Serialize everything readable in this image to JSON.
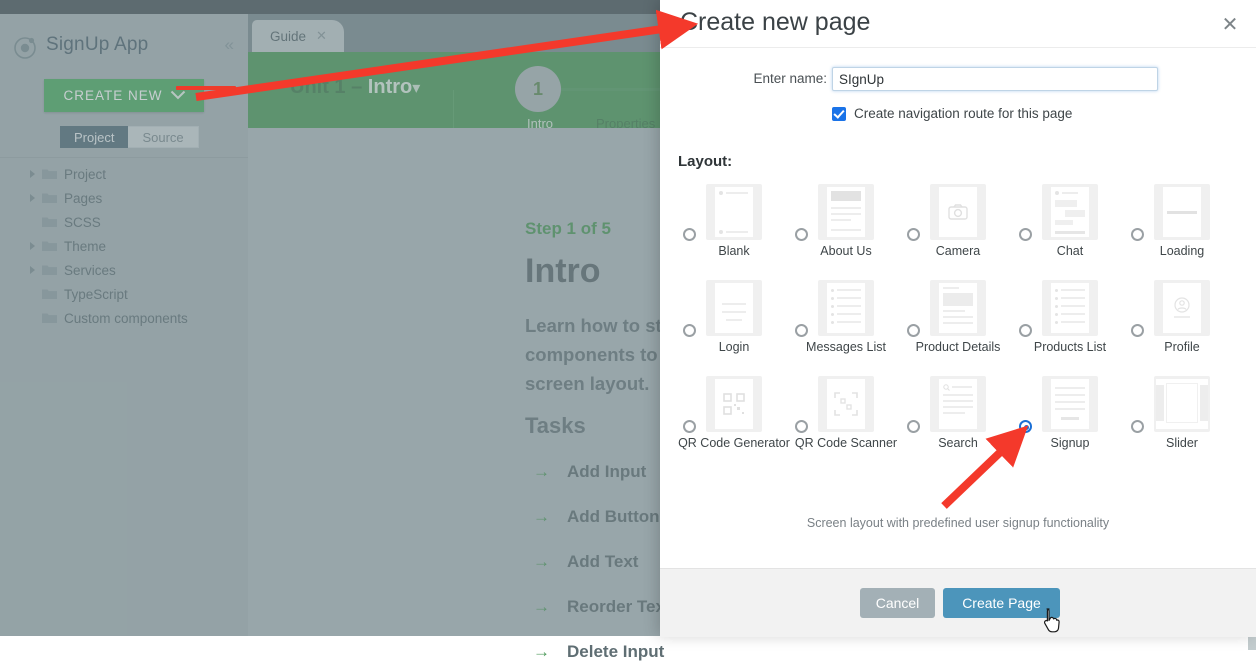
{
  "app": {
    "title": "SignUp App",
    "logo_icon": "target-orbit-icon",
    "collapse_icon": "chevron-double-left-icon",
    "create_new_label": "CREATE NEW",
    "create_new_chevron": "chevron-down-icon",
    "segments": [
      {
        "label": "Project",
        "active": true
      },
      {
        "label": "Source",
        "active": false
      }
    ],
    "tree": [
      {
        "label": "Project",
        "expandable": true
      },
      {
        "label": "Pages",
        "expandable": true
      },
      {
        "label": "SCSS",
        "expandable": false
      },
      {
        "label": "Theme",
        "expandable": true
      },
      {
        "label": "Services",
        "expandable": true
      },
      {
        "label": "TypeScript",
        "expandable": false
      },
      {
        "label": "Custom components",
        "expandable": false
      }
    ]
  },
  "workspace": {
    "tab": {
      "label": "Guide",
      "close_icon": "close-icon"
    },
    "unit_selector": {
      "prefix": "Unit 1 – ",
      "name": "Intro",
      "chevron": "chevron-down-icon"
    },
    "stepper": {
      "current_number": "1",
      "steps": [
        "Intro",
        "Properties"
      ]
    },
    "step_of": "Step 1 of 5",
    "heading": "Intro",
    "paragraph": "Learn how to start developing by adding UI components to the screen and modifying screen layout.",
    "tasks_heading": "Tasks",
    "tasks": [
      {
        "arrow_icon": "arrow-right-icon",
        "label": "Add Input"
      },
      {
        "arrow_icon": "arrow-right-icon",
        "label": "Add Button"
      },
      {
        "arrow_icon": "arrow-right-icon",
        "label": "Add Text"
      },
      {
        "arrow_icon": "arrow-right-icon",
        "label": "Reorder Text and Button"
      },
      {
        "arrow_icon": "arrow-right-icon",
        "label": "Delete Input"
      }
    ]
  },
  "modal": {
    "title": "Create new page",
    "close_icon": "close-icon",
    "name_label": "Enter name:",
    "name_value": "SIgnUp",
    "name_placeholder": "",
    "checkbox_label": "Create navigation route for this page",
    "checkbox_checked": true,
    "layout_label": "Layout:",
    "layouts": [
      {
        "label": "Blank",
        "thumb": "blank-thumb",
        "selected": false
      },
      {
        "label": "About Us",
        "thumb": "about-us-thumb",
        "selected": false
      },
      {
        "label": "Camera",
        "thumb": "camera-thumb",
        "selected": false
      },
      {
        "label": "Chat",
        "thumb": "chat-thumb",
        "selected": false
      },
      {
        "label": "Loading",
        "thumb": "loading-thumb",
        "selected": false
      },
      {
        "label": "Login",
        "thumb": "login-thumb",
        "selected": false
      },
      {
        "label": "Messages List",
        "thumb": "messages-list-thumb",
        "selected": false
      },
      {
        "label": "Product Details",
        "thumb": "product-details-thumb",
        "selected": false
      },
      {
        "label": "Products List",
        "thumb": "products-list-thumb",
        "selected": false
      },
      {
        "label": "Profile",
        "thumb": "profile-thumb",
        "selected": false
      },
      {
        "label": "QR Code Generator",
        "thumb": "qr-code-generator-thumb",
        "selected": false
      },
      {
        "label": "QR Code Scanner",
        "thumb": "qr-code-scanner-thumb",
        "selected": false
      },
      {
        "label": "Search",
        "thumb": "search-thumb",
        "selected": false
      },
      {
        "label": "Signup",
        "thumb": "signup-thumb",
        "selected": true
      },
      {
        "label": "Slider",
        "thumb": "slider-thumb",
        "selected": false
      }
    ],
    "description": "Screen layout with predefined user signup functionality",
    "cancel_label": "Cancel",
    "create_label": "Create Page"
  },
  "colors": {
    "accent_green": "#4caf63",
    "header_green": "#4d9c5b",
    "primary_blue": "#4c95bb",
    "radio_blue": "#1a6fd6",
    "checkbox_blue": "#1a73e8",
    "annotation_red": "#ee3b2b",
    "topbar": "#4a565c",
    "sidebar": "#a9b6b9"
  }
}
